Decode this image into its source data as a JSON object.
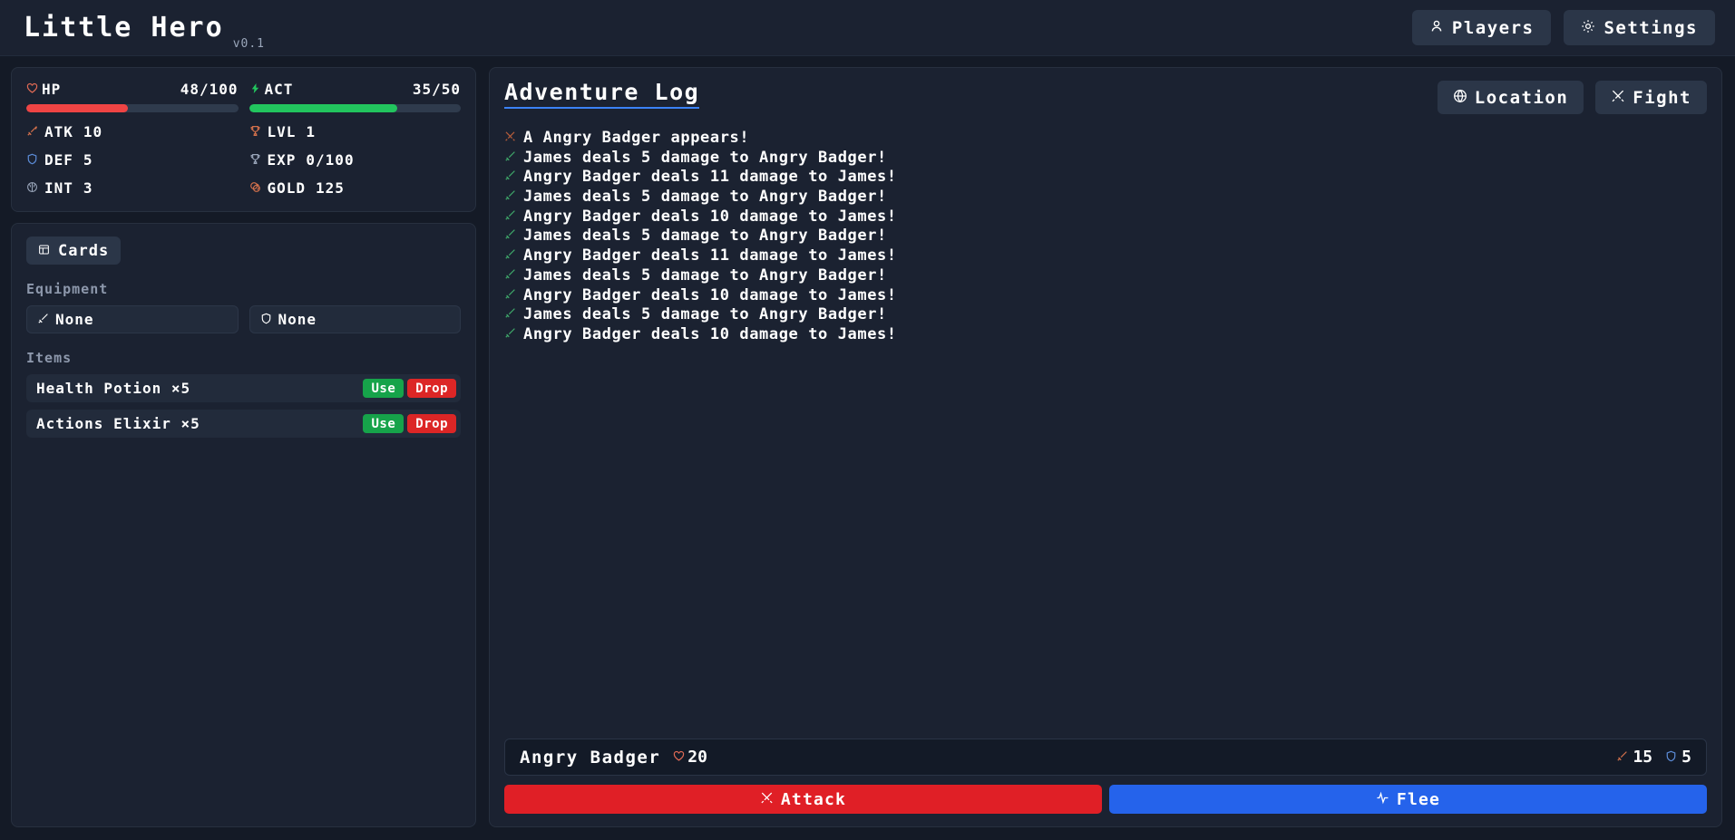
{
  "header": {
    "title": "Little Hero",
    "version": "v0.1",
    "buttons": [
      {
        "label": "Players",
        "icon": "user-icon"
      },
      {
        "label": "Settings",
        "icon": "gear-icon"
      }
    ]
  },
  "stats": {
    "hp": {
      "label": "HP",
      "value": "48/100",
      "current": 48,
      "max": 100,
      "percent": 48,
      "color": "#ef4444",
      "icon": "heart-icon"
    },
    "act": {
      "label": "ACT",
      "value": "35/50",
      "current": 35,
      "max": 50,
      "percent": 70,
      "color": "#22c55e",
      "icon": "lightning-icon"
    },
    "atk": {
      "label": "ATK",
      "value": "10",
      "icon": "sword-icon"
    },
    "def": {
      "label": "DEF",
      "value": "5",
      "icon": "shield-icon"
    },
    "int": {
      "label": "INT",
      "value": "3",
      "icon": "brain-icon"
    },
    "lvl": {
      "label": "LVL",
      "value": "1",
      "icon": "trophy-icon"
    },
    "exp": {
      "label": "EXP",
      "value": "0/100",
      "icon": "trophy-icon"
    },
    "gold": {
      "label": "GOLD",
      "value": "125",
      "icon": "coins-icon"
    }
  },
  "inventory": {
    "cards_button": {
      "label": "Cards",
      "icon": "layout-icon"
    },
    "equipment_label": "Equipment",
    "equipment": [
      {
        "label": "None",
        "icon": "sword-icon"
      },
      {
        "label": "None",
        "icon": "shield-icon"
      }
    ],
    "items_label": "Items",
    "items": [
      {
        "name": "Health Potion ×5",
        "use_label": "Use",
        "drop_label": "Drop"
      },
      {
        "name": "Actions Elixir ×5",
        "use_label": "Use",
        "drop_label": "Drop"
      }
    ]
  },
  "log": {
    "title": "Adventure Log",
    "buttons": [
      {
        "label": "Location",
        "icon": "globe-icon"
      },
      {
        "label": "Fight",
        "icon": "swords-icon"
      }
    ],
    "entries": [
      {
        "text": "A Angry Badger appears!",
        "icon": "swords-icon",
        "icon_color": "#b45c3a"
      },
      {
        "text": "James deals 5 damage to Angry Badger!",
        "icon": "sword-icon",
        "icon_color": "#3fa86a"
      },
      {
        "text": "Angry Badger deals 11 damage to James!",
        "icon": "sword-icon",
        "icon_color": "#3fa86a"
      },
      {
        "text": "James deals 5 damage to Angry Badger!",
        "icon": "sword-icon",
        "icon_color": "#3fa86a"
      },
      {
        "text": "Angry Badger deals 10 damage to James!",
        "icon": "sword-icon",
        "icon_color": "#3fa86a"
      },
      {
        "text": "James deals 5 damage to Angry Badger!",
        "icon": "sword-icon",
        "icon_color": "#3fa86a"
      },
      {
        "text": "Angry Badger deals 11 damage to James!",
        "icon": "sword-icon",
        "icon_color": "#3fa86a"
      },
      {
        "text": "James deals 5 damage to Angry Badger!",
        "icon": "sword-icon",
        "icon_color": "#3fa86a"
      },
      {
        "text": "Angry Badger deals 10 damage to James!",
        "icon": "sword-icon",
        "icon_color": "#3fa86a"
      },
      {
        "text": "James deals 5 damage to Angry Badger!",
        "icon": "sword-icon",
        "icon_color": "#3fa86a"
      },
      {
        "text": "Angry Badger deals 10 damage to James!",
        "icon": "sword-icon",
        "icon_color": "#3fa86a"
      }
    ]
  },
  "combat": {
    "enemy_name": "Angry Badger",
    "enemy_hp": "20",
    "enemy_atk": "15",
    "enemy_def": "5",
    "attack_label": "Attack",
    "flee_label": "Flee"
  }
}
